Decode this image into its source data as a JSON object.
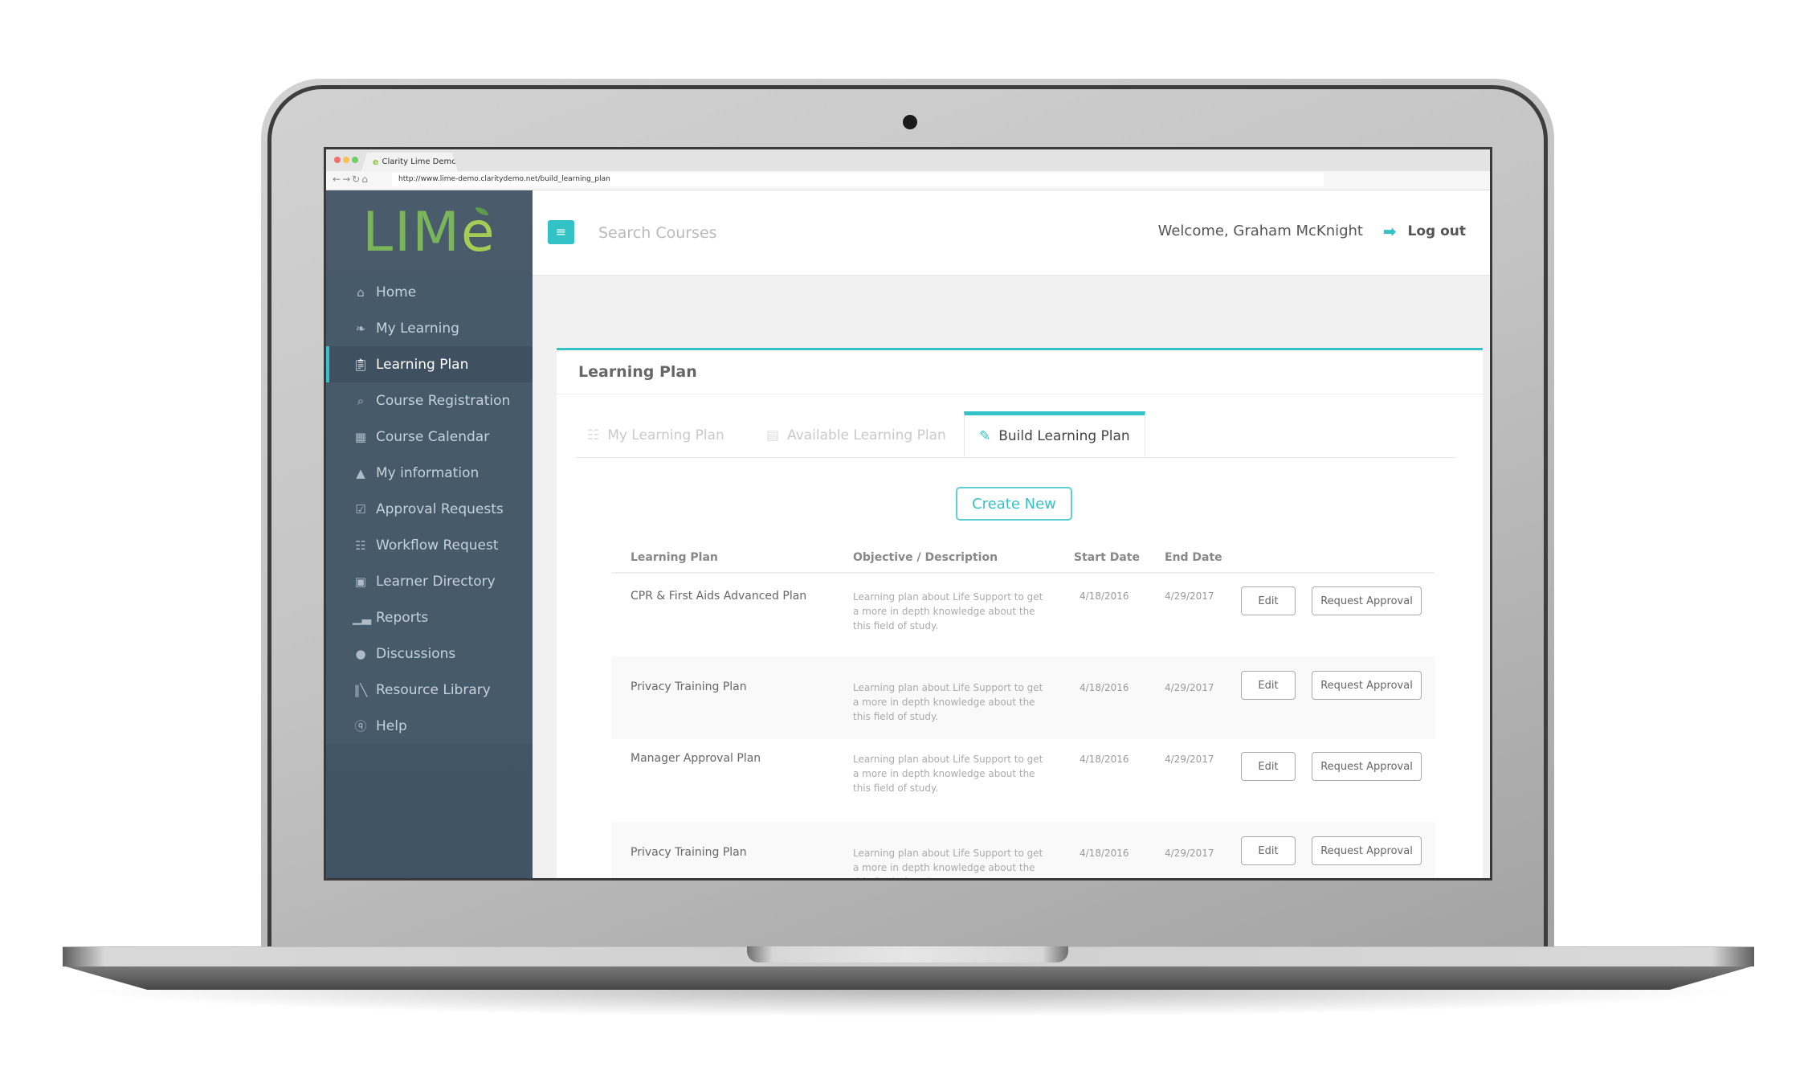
{
  "browser": {
    "tab_title": "Clarity Lime Demo",
    "url": "http://www.lime-demo.claritydemo.net/build_learning_plan",
    "nav_icons": [
      "back-arrow",
      "forward-arrow",
      "reload",
      "home"
    ]
  },
  "brand": {
    "logo_text_main": "LIM",
    "logo_text_accent": "e",
    "accent_color": "#33c3c6",
    "sidebar_color": "#475a6a",
    "logo_green": "#7ab55c"
  },
  "sidebar": {
    "items": [
      {
        "label": "Home",
        "icon": "home-icon",
        "active": false
      },
      {
        "label": "My Learning",
        "icon": "leaf-icon",
        "active": false
      },
      {
        "label": "Learning Plan",
        "icon": "clipboard-icon",
        "active": true
      },
      {
        "label": "Course Registration",
        "icon": "search-icon",
        "active": false
      },
      {
        "label": "Course Calendar",
        "icon": "calendar-icon",
        "active": false
      },
      {
        "label": "My information",
        "icon": "graduation-cap-icon",
        "active": false
      },
      {
        "label": "Approval Requests",
        "icon": "clipboard-check-icon",
        "active": false
      },
      {
        "label": "Workflow Request",
        "icon": "sitemap-icon",
        "active": false
      },
      {
        "label": "Learner Directory",
        "icon": "address-book-icon",
        "active": false
      },
      {
        "label": "Reports",
        "icon": "bar-chart-icon",
        "active": false
      },
      {
        "label": "Discussions",
        "icon": "comments-icon",
        "active": false
      },
      {
        "label": "Resource Library",
        "icon": "books-icon",
        "active": false
      },
      {
        "label": "Help",
        "icon": "question-circle-icon",
        "active": false
      }
    ]
  },
  "header": {
    "search_placeholder": "Search Courses",
    "welcome_text": "Welcome, Graham McKnight",
    "logout_label": "Log out"
  },
  "card": {
    "title": "Learning Plan",
    "tabs": [
      {
        "label": "My Learning Plan",
        "icon": "sitemap-icon",
        "active": false
      },
      {
        "label": "Available Learning Plan",
        "icon": "clipboard-icon",
        "active": false
      },
      {
        "label": "Build Learning Plan",
        "icon": "edit-icon",
        "active": true
      }
    ],
    "create_label": "Create New"
  },
  "table": {
    "columns": [
      "Learning Plan",
      "Objective / Description",
      "Start Date",
      "End Date"
    ],
    "edit_label": "Edit",
    "request_label": "Request Approval",
    "rows": [
      {
        "name": "CPR & First Aids Advanced Plan",
        "description": "Learning plan about Life Support to get a more in depth knowledge about the this field of study.",
        "start": "4/18/2016",
        "end": "4/29/2017",
        "edit": "Edit",
        "request": "Request Approval"
      },
      {
        "name": "Privacy Training Plan",
        "description": "Learning plan about Life Support to get a more in depth knowledge about the this field of study.",
        "start": "4/18/2016",
        "end": "4/29/2017",
        "edit": "Edit",
        "request": "Request Approval"
      },
      {
        "name": "Manager Approval Plan",
        "description": "Learning plan about Life Support to get a more in depth knowledge about the this field of study.",
        "start": "4/18/2016",
        "end": "4/29/2017",
        "edit": "Edit",
        "request": "Request Approval"
      },
      {
        "name": "Privacy Training Plan",
        "description": "Learning plan about Life Support to get a more in depth knowledge about the this field of study.",
        "start": "4/18/2016",
        "end": "4/29/2017",
        "edit": "Edit",
        "request": "Request Approval"
      }
    ]
  }
}
